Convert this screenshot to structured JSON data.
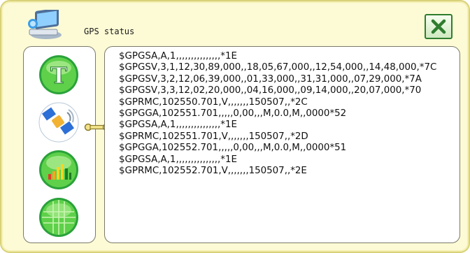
{
  "window": {
    "title": "GPS status"
  },
  "toolbar": {
    "close_icon": "close-x-icon"
  },
  "sidebar": {
    "items": [
      {
        "icon": "text-t-icon",
        "color": "#39b54a"
      },
      {
        "icon": "satellite-icon",
        "color": "#2c8fd6"
      },
      {
        "icon": "signal-bars-icon",
        "color": "#39b54a"
      },
      {
        "icon": "globe-grid-icon",
        "color": "#39b54a"
      }
    ]
  },
  "log": {
    "lines": [
      "$GPGSA,A,1,,,,,,,,,,,,,,,*1E",
      "$GPGSV,3,1,12,30,89,000,,18,05,67,000,,12,54,000,,14,48,000,*7C",
      "$GPGSV,3,2,12,06,39,000,,01,33,000,,31,31,000,,07,29,000,*7A",
      "$GPGSV,3,3,12,02,20,000,,04,16,000,,09,14,000,,20,07,000,*70",
      "$GPRMC,102550.701,V,,,,,,,150507,,*2C",
      "$GPGGA,102551.701,,,,,0,00,,,M,0.0,M,,0000*52",
      "$GPGSA,A,1,,,,,,,,,,,,,,,*1E",
      "$GPRMC,102551.701,V,,,,,,,150507,,*2D",
      "$GPGGA,102552.701,,,,,0,00,,,M,0.0,M,,0000*51",
      "$GPGSA,A,1,,,,,,,,,,,,,,,*1E",
      "$GPRMC,102552.701,V,,,,,,,150507,,*2E"
    ]
  },
  "colors": {
    "window_bg": "#fdfbd6",
    "accent_green": "#39b54a",
    "close_green": "#2f7d2f"
  }
}
